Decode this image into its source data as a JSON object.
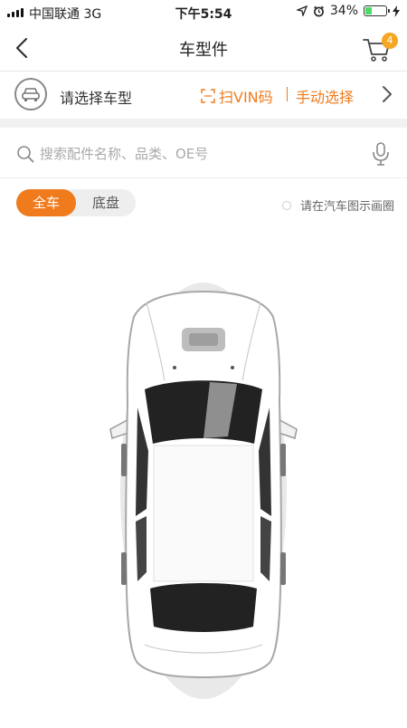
{
  "status_bar": {
    "carrier": "中国联通  3G",
    "time": "下午5:54",
    "battery_pct": "34%",
    "battery_level": 0.34
  },
  "nav": {
    "title": "车型件",
    "cart_count": "4"
  },
  "car_select": {
    "prompt": "请选择车型",
    "scan_label": "扫VIN码",
    "manual_label": "手动选择"
  },
  "search": {
    "placeholder": "搜索配件名称、品类、OE号"
  },
  "tabs": {
    "items": [
      {
        "label": "全车",
        "active": true
      },
      {
        "label": "底盘",
        "active": false
      }
    ]
  },
  "hint": {
    "text": "请在汽车图示画圈"
  },
  "colors": {
    "accent": "#f07b1d",
    "badge": "#f5a623",
    "battery": "#4cd964"
  },
  "icons": [
    "back-icon",
    "cart-icon",
    "car-icon",
    "scan-icon",
    "chevron-right-icon",
    "search-icon",
    "microphone-icon",
    "location-icon",
    "alarm-icon",
    "charging-icon"
  ]
}
